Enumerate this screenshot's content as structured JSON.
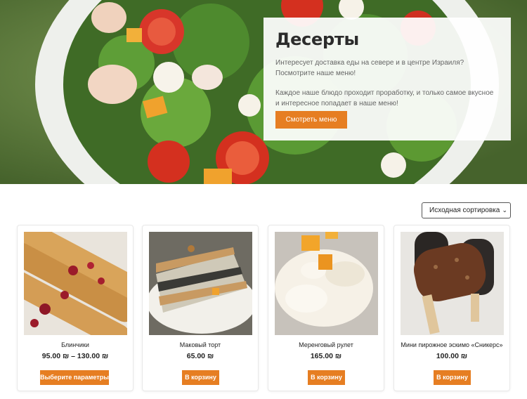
{
  "hero": {
    "title": "Десерты",
    "text1": "Интересует доставка еды на севере и в центре Израиля? Посмотрите наше меню!",
    "text2": "Каждое наше блюдо проходит проработку, и только самое вкусное и интересное попадает в наше меню!",
    "button_label": "Смотреть меню"
  },
  "sort": {
    "selected": "Исходная сортировка",
    "chevron": "⌄"
  },
  "products": [
    {
      "name": "Блинчики",
      "price": "95.00 ₪ – 130.00 ₪",
      "button_label": "Выберите параметры"
    },
    {
      "name": "Маковый торт",
      "price": "65.00 ₪",
      "button_label": "В корзину"
    },
    {
      "name": "Меренговый рулет",
      "price": "165.00 ₪",
      "button_label": "В корзину"
    },
    {
      "name": "Мини пирожное эскимо «Сникерс»",
      "price": "100.00 ₪",
      "button_label": "В корзину"
    }
  ],
  "colors": {
    "accent": "#e67e22"
  }
}
